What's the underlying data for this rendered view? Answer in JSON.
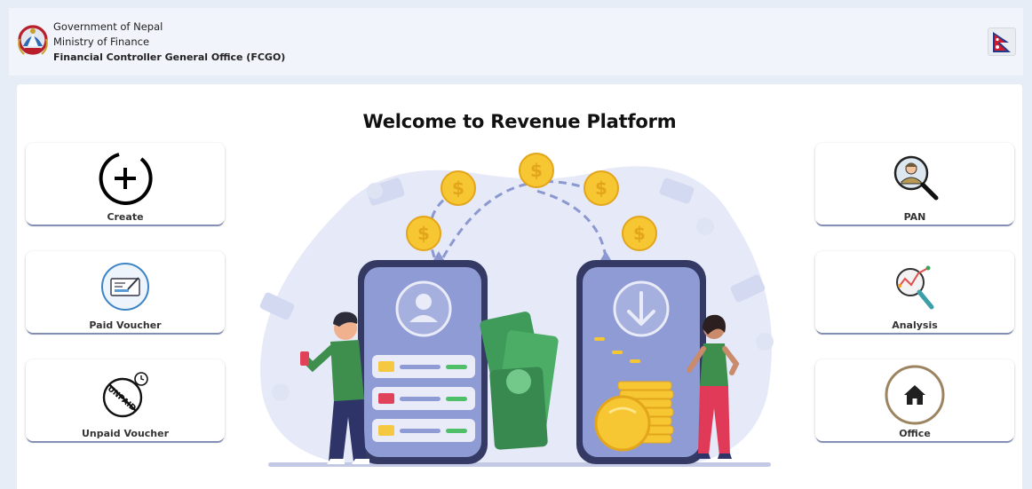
{
  "header": {
    "line1": "Government of Nepal",
    "line2": "Ministry of Finance",
    "line3": "Financial Controller General Office (FCGO)"
  },
  "main": {
    "title": "Welcome to Revenue Platform"
  },
  "cards": {
    "create": "Create",
    "paid_voucher": "Paid Voucher",
    "unpaid_voucher": "Unpaid Voucher",
    "pan": "PAN",
    "analysis": "Analysis",
    "office": "Office"
  },
  "icons": {
    "emblem": "nepal-emblem-icon",
    "flag": "nepal-flag-icon",
    "create": "plus-circle-icon",
    "paid_voucher": "cheque-icon",
    "unpaid_voucher": "unpaid-stamp-icon",
    "pan": "person-search-icon",
    "analysis": "chart-magnifier-icon",
    "office": "home-icon"
  },
  "colors": {
    "background": "#e7edf6",
    "header": "#f1f4fa",
    "card_shadow": "#8f9bc3",
    "illustration_blue": "#6f7ec4",
    "coin": "#f7c633",
    "money": "#3f9b5a"
  }
}
